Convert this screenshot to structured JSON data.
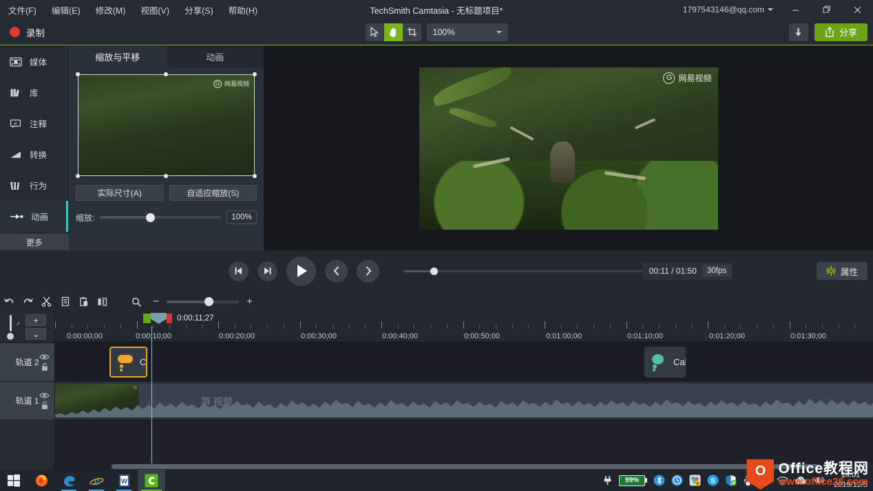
{
  "titlebar": {
    "menus": [
      {
        "label": "文件(F)"
      },
      {
        "label": "编辑(E)"
      },
      {
        "label": "修改(M)"
      },
      {
        "label": "视图(V)"
      },
      {
        "label": "分享(S)"
      },
      {
        "label": "帮助(H)"
      }
    ],
    "title": "TechSmith Camtasia - 无标题项目*",
    "account": "1797543146@qq.com",
    "minimize": "—",
    "maximize": "❐",
    "close": "✕"
  },
  "toolbar": {
    "record_label": "录制",
    "zoom_value": "100%",
    "share_label": "分享",
    "tools": [
      {
        "name": "pointer-tool",
        "active": false
      },
      {
        "name": "hand-tool",
        "active": true
      },
      {
        "name": "crop-tool",
        "active": false
      }
    ]
  },
  "sidebar": {
    "items": [
      {
        "label": "媒体",
        "icon": "film-icon",
        "active": false
      },
      {
        "label": "库",
        "icon": "library-icon",
        "active": false
      },
      {
        "label": "注释",
        "icon": "callout-icon",
        "active": false
      },
      {
        "label": "转换",
        "icon": "transition-icon",
        "active": false
      },
      {
        "label": "行为",
        "icon": "behaviors-icon",
        "active": false
      },
      {
        "label": "动画",
        "icon": "animation-icon",
        "active": true
      }
    ],
    "more_label": "更多"
  },
  "properties": {
    "tabs": [
      {
        "label": "缩放与平移",
        "active": true
      },
      {
        "label": "动画",
        "active": false
      }
    ],
    "actual_size_label": "实际尺寸(A)",
    "fit_scale_label": "自适应缩放(S)",
    "zoom_label": "缩放:",
    "zoom_value": "100%",
    "preview_watermark": "网易视频"
  },
  "canvas": {
    "watermark": "网易视频"
  },
  "transport": {
    "prev_frame": "prev-frame",
    "next_frame": "next-frame",
    "play": "play",
    "back": "back",
    "forward": "forward",
    "current_time": "00:11 / 01:50",
    "fps": "30fps",
    "properties_label": "属性"
  },
  "timeline": {
    "tools": [
      {
        "name": "undo-icon"
      },
      {
        "name": "redo-icon"
      },
      {
        "name": "cut-icon"
      },
      {
        "name": "copy-icon"
      },
      {
        "name": "paste-icon"
      },
      {
        "name": "split-icon"
      }
    ],
    "search_icon": "search-icon",
    "zoom_out": "−",
    "zoom_in": "+",
    "add_track_label": "+",
    "collapse_label": "⌄",
    "playhead_time": "0:00:11;27",
    "ruler_labels": [
      "0:00:00;00",
      "0:00:10;00",
      "0:00:20;00",
      "0:00:30;00",
      "0:00:40;00",
      "0:00:50;00",
      "0:01:00;00",
      "0:01:10;00",
      "0:01:20;00",
      "0:01:30;00"
    ],
    "tracks": [
      {
        "name": "轨道 2",
        "eye": "eye-icon",
        "lock": "lock-icon"
      },
      {
        "name": "轨道 1",
        "eye": "eye-icon",
        "lock": "lock-icon"
      }
    ],
    "clips": [
      {
        "label": "Ca",
        "icon": "cloud-rain-icon",
        "color": "#f0a72b",
        "selected": true,
        "track": 2
      },
      {
        "label": "Cal",
        "icon": "blob-icon",
        "color": "#55bda8",
        "selected": false,
        "track": 2
      },
      {
        "label": "笋 视频",
        "icon": "video-clip",
        "selected": false,
        "track": 1
      }
    ]
  },
  "taskbar": {
    "apps": [
      {
        "name": "start-button"
      },
      {
        "name": "firefox-icon"
      },
      {
        "name": "edge-icon"
      },
      {
        "name": "internet-explorer-icon"
      },
      {
        "name": "word-icon"
      },
      {
        "name": "camtasia-icon"
      }
    ],
    "battery": "99%",
    "tray_icons": [
      "plug-icon",
      "bluetooth-icon",
      "clock-icon",
      "shield-lock-icon",
      "skype-icon",
      "security-icon",
      "qq-icon",
      "mcafee-icon",
      "wifi-icon",
      "cloud-icon",
      "volume-icon"
    ],
    "clock_time": "14:01",
    "clock_date": "2019/12/5"
  },
  "watermark": {
    "badge": "O",
    "line1": "Office教程网",
    "line2": "www.office26.com"
  }
}
